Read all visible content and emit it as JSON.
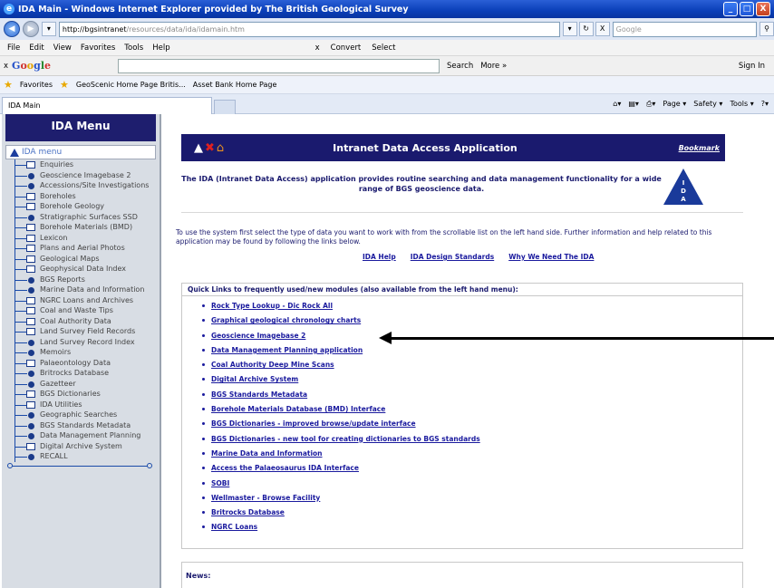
{
  "window": {
    "title": "IDA Main - Windows Internet Explorer provided by The British Geological Survey",
    "min": "_",
    "max": "□",
    "close": "X"
  },
  "address": {
    "host": "http://bgsintranet",
    "path": "/resources/data/ida/idamain.htm",
    "search_placeholder": "Google",
    "refresh": "↻",
    "stop": "X"
  },
  "menubar": {
    "items": [
      "File",
      "Edit",
      "View",
      "Favorites",
      "Tools",
      "Help"
    ],
    "convert": "Convert",
    "select": "Select"
  },
  "google_bar": {
    "close": "x",
    "logo": [
      "G",
      "o",
      "o",
      "g",
      "l",
      "e"
    ],
    "search": "Search",
    "more": "More »",
    "signin": "Sign In"
  },
  "favorites": {
    "label": "Favorites",
    "items": [
      "GeoScenic Home Page Britis...",
      "Asset Bank Home Page"
    ]
  },
  "tab": {
    "title": "IDA Main",
    "commands": [
      "Page",
      "Safety",
      "Tools"
    ]
  },
  "sidebar": {
    "title": "IDA Menu",
    "root": "IDA menu",
    "items": [
      {
        "label": "Enquiries",
        "type": "folder"
      },
      {
        "label": "Geoscience Imagebase 2",
        "type": "dot"
      },
      {
        "label": "Accessions/Site Investigations",
        "type": "dot"
      },
      {
        "label": "Boreholes",
        "type": "folder"
      },
      {
        "label": "Borehole Geology",
        "type": "folder"
      },
      {
        "label": "Stratigraphic Surfaces SSD",
        "type": "dot"
      },
      {
        "label": "Borehole Materials (BMD)",
        "type": "folder"
      },
      {
        "label": "Lexicon",
        "type": "folder"
      },
      {
        "label": "Plans and Aerial Photos",
        "type": "folder"
      },
      {
        "label": "Geological Maps",
        "type": "folder"
      },
      {
        "label": "Geophysical Data Index",
        "type": "folder"
      },
      {
        "label": "BGS Reports",
        "type": "dot"
      },
      {
        "label": "Marine Data and Information",
        "type": "dot"
      },
      {
        "label": "NGRC Loans and Archives",
        "type": "folder"
      },
      {
        "label": "Coal and Waste Tips",
        "type": "folder"
      },
      {
        "label": "Coal Authority Data",
        "type": "folder"
      },
      {
        "label": "Land Survey Field Records",
        "type": "folder"
      },
      {
        "label": "Land Survey Record Index",
        "type": "dot"
      },
      {
        "label": "Memoirs",
        "type": "dot"
      },
      {
        "label": "Palaeontology Data",
        "type": "folder"
      },
      {
        "label": "Britrocks Database",
        "type": "dot"
      },
      {
        "label": "Gazetteer",
        "type": "dot"
      },
      {
        "label": "BGS Dictionaries",
        "type": "folder"
      },
      {
        "label": "IDA Utilities",
        "type": "folder"
      },
      {
        "label": "Geographic Searches",
        "type": "dot"
      },
      {
        "label": "BGS Standards Metadata",
        "type": "dot"
      },
      {
        "label": "Data Management Planning",
        "type": "dot"
      },
      {
        "label": "Digital Archive System",
        "type": "folder"
      },
      {
        "label": "RECALL",
        "type": "dot"
      }
    ]
  },
  "banner": {
    "title": "Intranet Data Access Application",
    "bookmark": "Bookmark"
  },
  "intro": "The IDA (Intranet Data Access) application provides routine searching and data management functionality for a wide range of BGS geoscience data.",
  "ida_logo": [
    "I",
    "D",
    "A"
  ],
  "description": "To use the system first select the type of data you want to work with from the scrollable list on the left hand side. Further information and help related to this application may be found by following the links below.",
  "help_links": [
    "IDA Help",
    "IDA Design Standards",
    "Why We Need The IDA"
  ],
  "quick_links": {
    "heading": "Quick Links to frequently used/new modules (also available from the left hand menu):",
    "items": [
      "Rock Type Lookup - Dic Rock All",
      "Graphical geological chronology charts",
      "Geoscience Imagebase 2",
      "Data Management Planning application",
      "Coal Authority Deep Mine Scans",
      "Digital Archive System",
      "BGS Standards Metadata",
      "Borehole Materials Database (BMD) Interface",
      "BGS Dictionaries - improved browse/update interface",
      "BGS Dictionaries - new tool for creating dictionaries to BGS standards",
      "Marine Data and Information",
      "Access the Palaeosaurus IDA Interface",
      "SOBI",
      "Wellmaster - Browse Facility",
      "Britrocks Database",
      "NGRC Loans"
    ]
  },
  "news": {
    "heading": "News:"
  }
}
